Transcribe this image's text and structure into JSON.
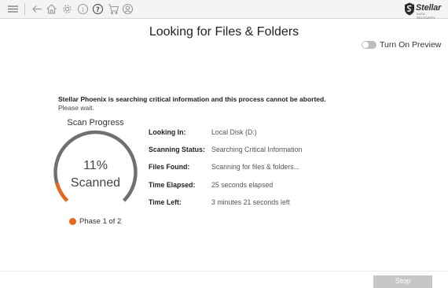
{
  "toolbar": {
    "icons": [
      "menu-icon",
      "back-icon",
      "home-icon",
      "settings-icon",
      "info-icon",
      "help-icon",
      "cart-icon",
      "user-icon"
    ],
    "logo": {
      "brand": "Stellar",
      "sub": "DATA RECOVERY"
    }
  },
  "page": {
    "title": "Looking for Files & Folders"
  },
  "preview": {
    "label": "Turn On Preview",
    "enabled": false
  },
  "notice": {
    "warning": "Stellar Phoenix is searching critical information and this process cannot be aborted.",
    "wait": "Please wait."
  },
  "progress": {
    "title": "Scan Progress",
    "percent_text": "11%",
    "status_word": "Scanned",
    "fraction": 0.11,
    "phase": "Phase 1 of 2"
  },
  "details": [
    {
      "label": "Looking In:",
      "value": "Local Disk (D:)"
    },
    {
      "label": "Scanning Status:",
      "value": "Searching Critical Information"
    },
    {
      "label": "Files Found:",
      "value": "Scanning for files & folders..."
    },
    {
      "label": "Time Elapsed:",
      "value": "25 seconds elapsed"
    },
    {
      "label": "Time Left:",
      "value": "3 minutes 21 seconds left"
    }
  ],
  "actions": {
    "stop_label": "Stop"
  },
  "colors": {
    "accent": "#e8651f",
    "track": "#707070",
    "button_disabled": "#c7c7c7"
  }
}
